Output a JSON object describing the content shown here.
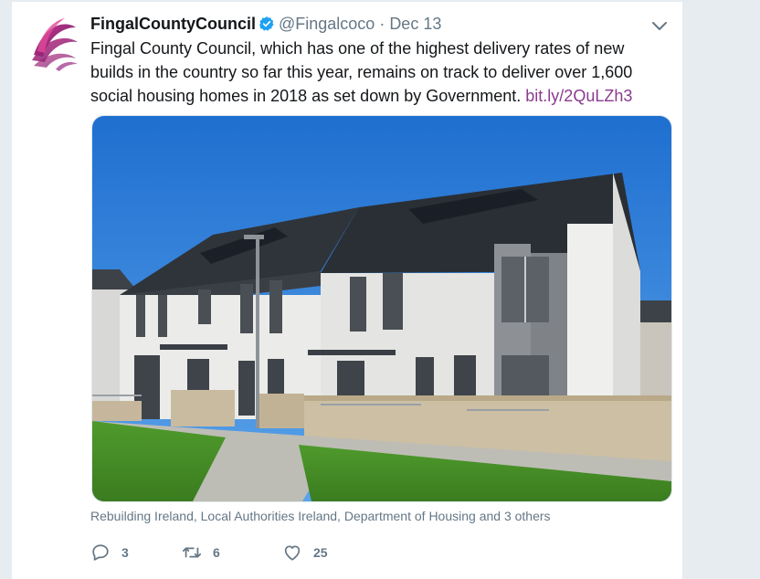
{
  "tweet": {
    "display_name": "FingalCountyCouncil",
    "handle": "@Fingalcoco",
    "separator": "·",
    "date": "Dec 13",
    "text": "Fingal County Council, which has one of the highest delivery rates of new builds in the country so far this year, remains on track to deliver over 1,600 social housing homes in 2018 as set down by Government.",
    "link": "bit.ly/2QuLZh3",
    "tagged_people": "Rebuilding Ireland, Local Authorities Ireland, Department of Housing and 3 others",
    "reply_count": "3",
    "retweet_count": "6",
    "like_count": "25"
  },
  "icons": {
    "avatar": "fingal-logo",
    "verified": "verified-badge-icon",
    "caret": "chevron-down-icon",
    "reply": "reply-icon",
    "retweet": "retweet-icon",
    "like": "heart-icon"
  },
  "colors": {
    "link": "#8c3a8e",
    "verified": "#1da1f2",
    "muted": "#657786"
  }
}
